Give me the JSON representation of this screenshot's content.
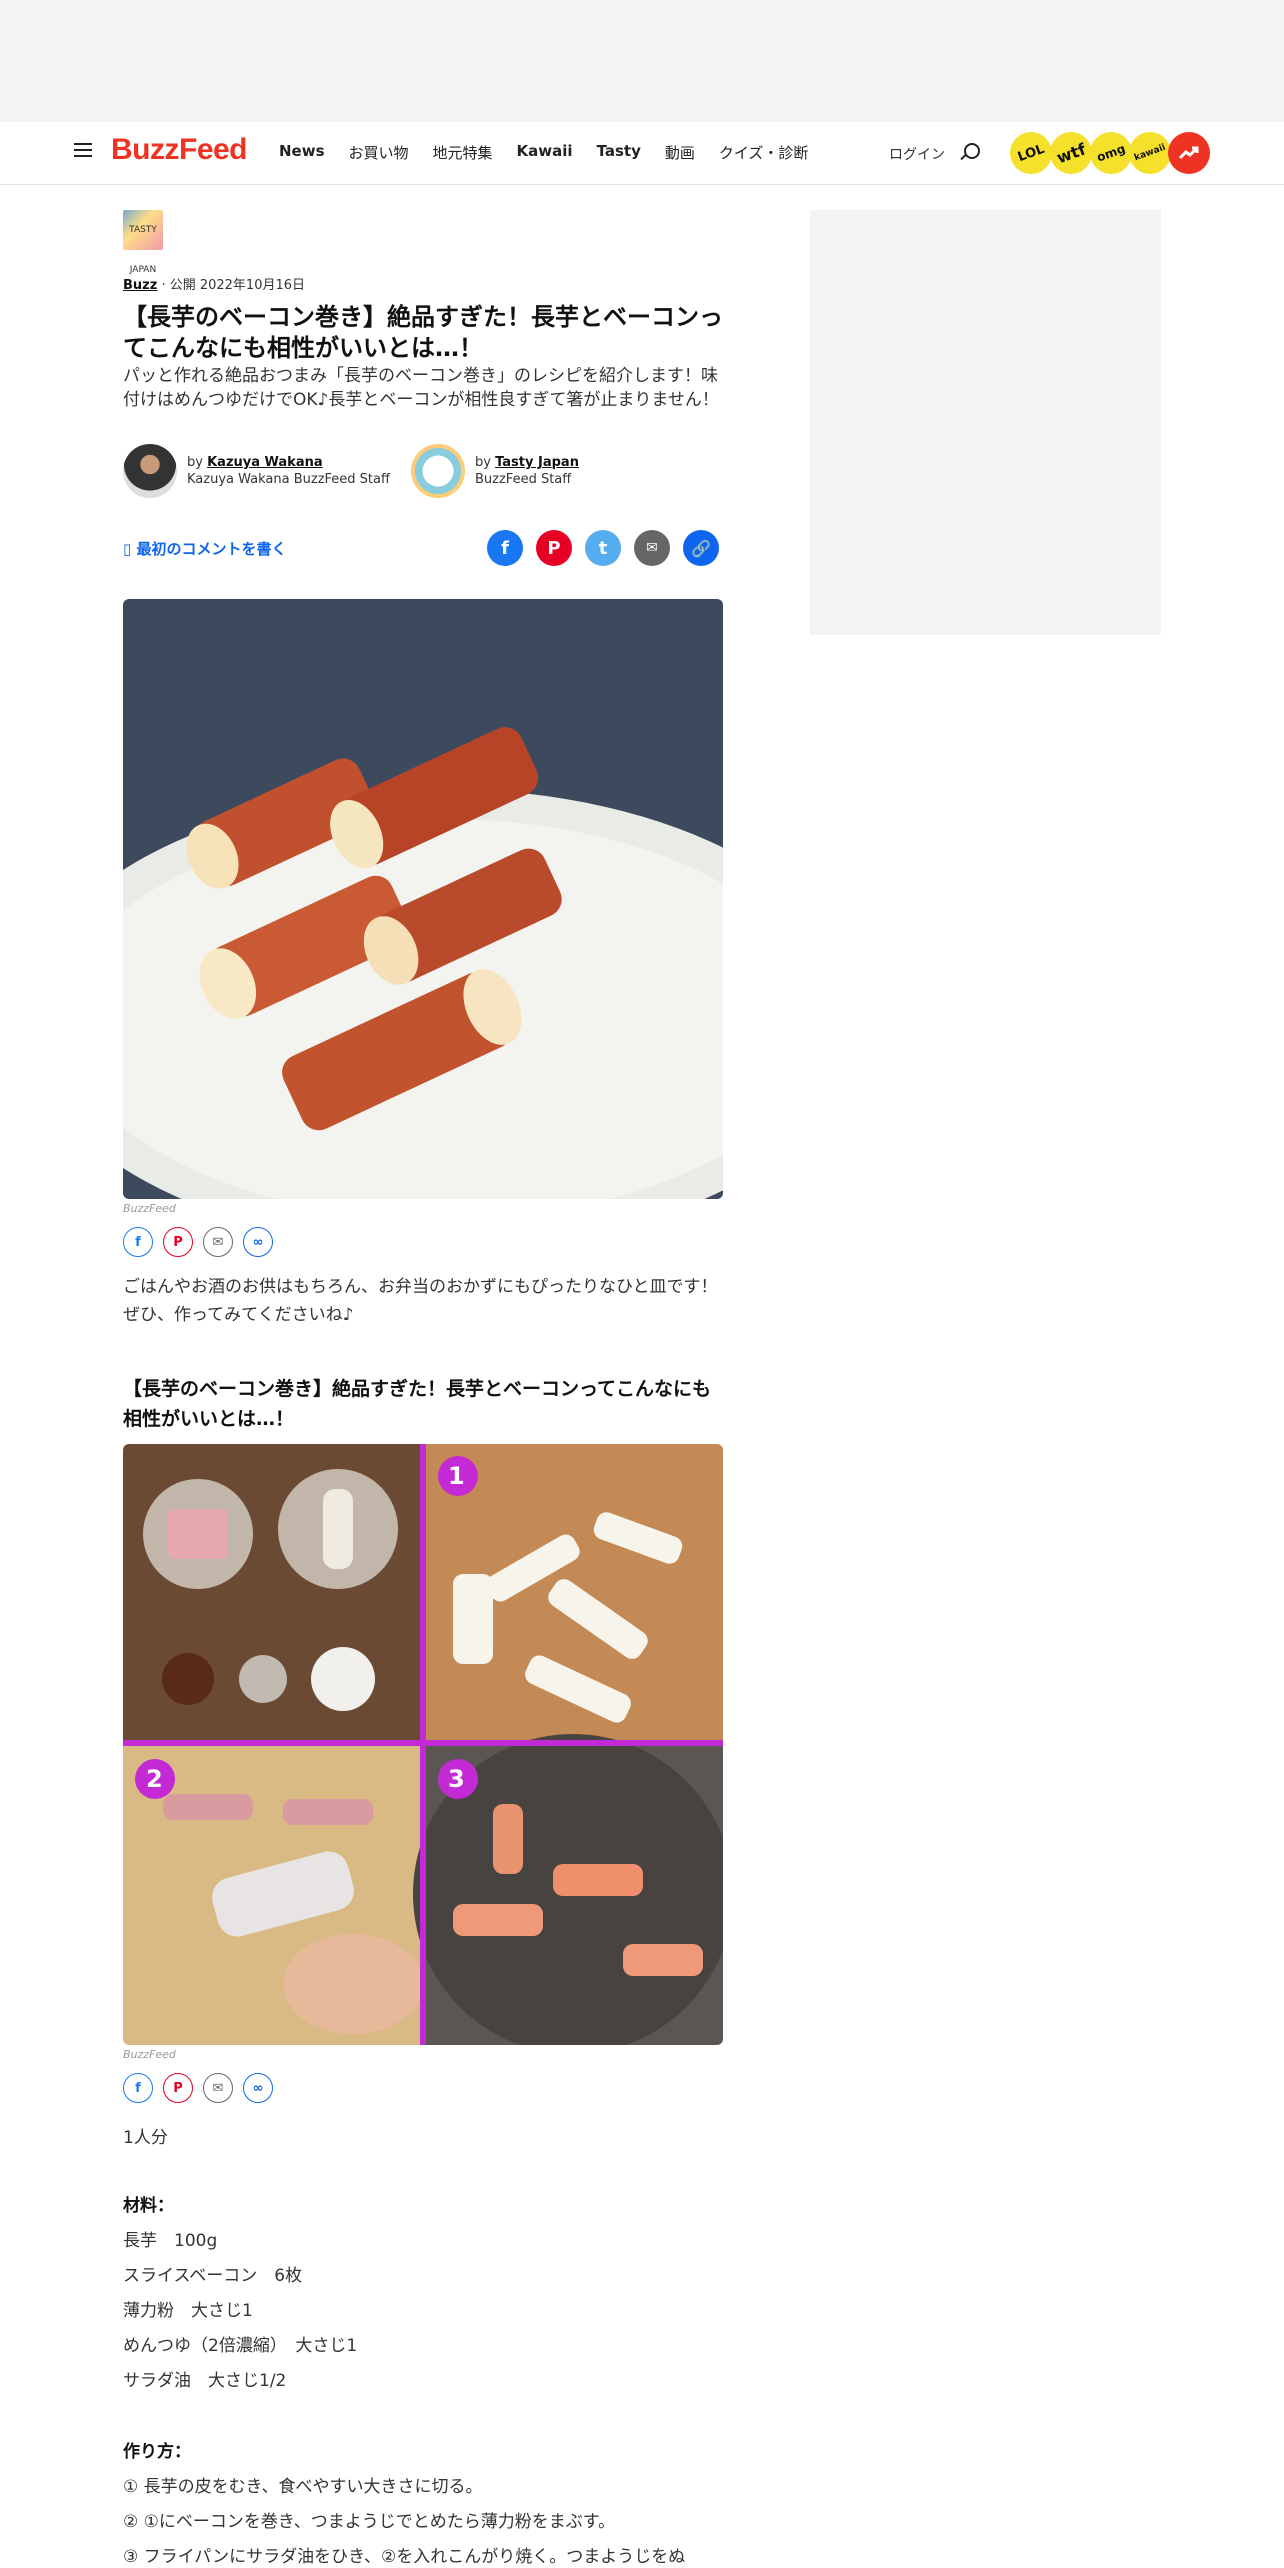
{
  "nav": {
    "logo": "BuzzFeed",
    "links": [
      {
        "label": "News",
        "bold": true
      },
      {
        "label": "お買い物",
        "bold": false
      },
      {
        "label": "地元特集",
        "bold": false
      },
      {
        "label": "Kawaii",
        "bold": true
      },
      {
        "label": "Tasty",
        "bold": true
      },
      {
        "label": "動画",
        "bold": false
      },
      {
        "label": "クイズ・診断",
        "bold": false
      }
    ],
    "login": "ログイン",
    "badges": [
      "LOL",
      "wtf",
      "omg",
      "kawaii"
    ]
  },
  "article": {
    "thumb_text": "TASTY JAPAN",
    "category": "Buzz",
    "published": "公開 2022年10月16日",
    "title": "【長芋のベーコン巻き】絶品すぎた！長芋とベーコンってこんなにも相性がいいとは…！",
    "dek": "パッと作れる絶品おつまみ「長芋のベーコン巻き」のレシピを紹介します！味付けはめんつゆだけでOK♪長芋とベーコンが相性良すぎて箸が止まりません！",
    "authors": [
      {
        "by": "by",
        "name": "Kazuya Wakana",
        "role": "Kazuya Wakana BuzzFeed Staff"
      },
      {
        "by": "by",
        "name": "Tasty Japan",
        "role": "BuzzFeed Staff"
      }
    ],
    "comment_cta": "最初のコメントを書く",
    "photo_credit": "BuzzFeed",
    "intro": "ごはんやお酒のお供はもちろん、お弁当のおかずにもぴったりなひと皿です！ぜひ、作ってみてくださいね♪",
    "recipe_title": "【長芋のベーコン巻き】絶品すぎた！長芋とベーコンってこんなにも相性がいいとは…！",
    "steps_credit": "BuzzFeed",
    "step_numbers": [
      "1",
      "2",
      "3"
    ],
    "servings": "1人分",
    "ingredients_heading": "材料：",
    "ingredients": [
      "長芋　100g",
      "スライスベーコン　6枚",
      "薄力粉　大さじ1",
      "めんつゆ（2倍濃縮）　大さじ1",
      "サラダ油　大さじ1/2"
    ],
    "method_heading": "作り方：",
    "method": [
      "① 長芋の皮をむき、食べやすい大きさに切る。",
      "② ①にベーコンを巻き、つまようじでとめたら薄力粉をまぶす。",
      "③ フライパンにサラダ油をひき、②を入れこんがり焼く。つまようじをぬ"
    ]
  },
  "colors": {
    "brand": "#ee3322",
    "link": "#0f65ef",
    "facebook": "#1877f2",
    "pinterest": "#e60023",
    "twitter": "#55acee",
    "step_accent": "#c32ad6"
  }
}
